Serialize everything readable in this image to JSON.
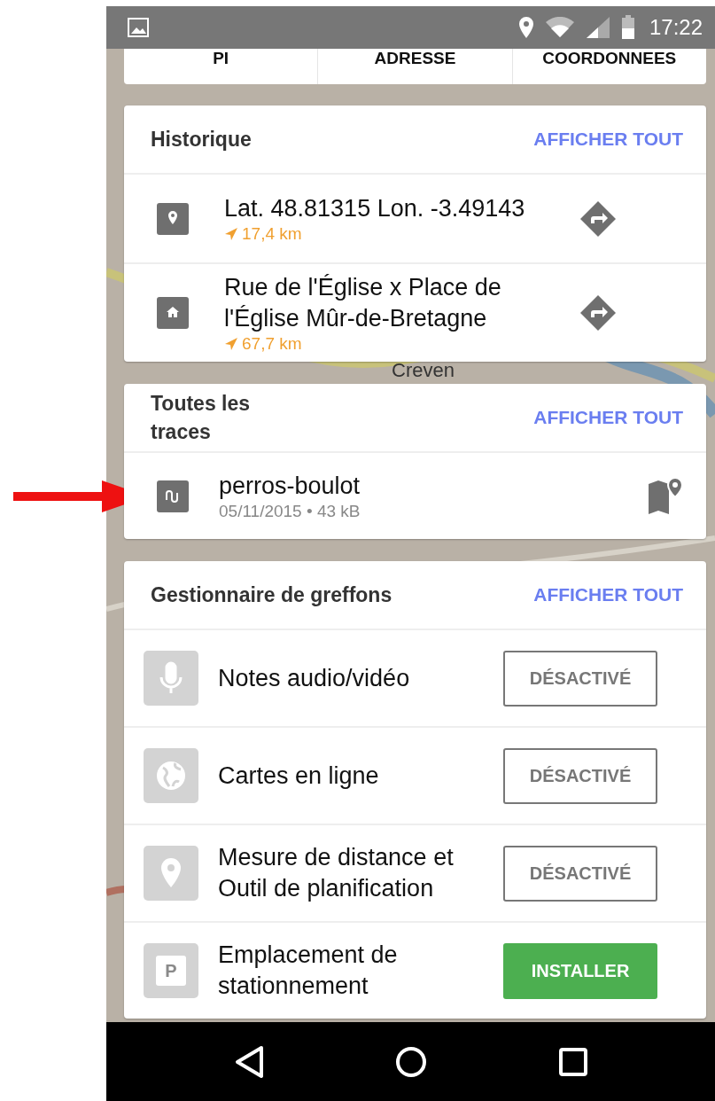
{
  "status_bar": {
    "time": "17:22"
  },
  "tabs": [
    {
      "label": "PI"
    },
    {
      "label": "ADRESSE"
    },
    {
      "label": "COORDONNEES"
    }
  ],
  "map_labels": [
    "Creven"
  ],
  "history": {
    "title": "Historique",
    "action": "AFFICHER TOUT",
    "items": [
      {
        "kind": "location",
        "title": "Lat. 48.81315 Lon. -3.49143",
        "distance": "17,4 km"
      },
      {
        "kind": "home",
        "title": "Rue de l'Église x Place de l'Église Mûr-de-Bretagne",
        "distance": "67,7 km"
      }
    ]
  },
  "traces": {
    "title": "Toutes les traces",
    "action": "AFFICHER TOUT",
    "items": [
      {
        "name": "perros-boulot",
        "meta": "05/11/2015 • 43 kB"
      }
    ]
  },
  "plugins": {
    "title": "Gestionnaire de greffons",
    "action": "AFFICHER TOUT",
    "items": [
      {
        "kind": "audio",
        "name": "Notes audio/vidéo",
        "button": {
          "kind": "toggle",
          "label": "DÉSACTIVÉ"
        }
      },
      {
        "kind": "online-maps",
        "name": "Cartes en ligne",
        "button": {
          "kind": "toggle",
          "label": "DÉSACTIVÉ"
        }
      },
      {
        "kind": "distance",
        "name": "Mesure de distance et Outil de planification",
        "button": {
          "kind": "toggle",
          "label": "DÉSACTIVÉ"
        }
      },
      {
        "kind": "parking",
        "name": "Emplacement de stationnement",
        "icon_text": "P",
        "button": {
          "kind": "install",
          "label": "INSTALLER"
        }
      }
    ]
  }
}
